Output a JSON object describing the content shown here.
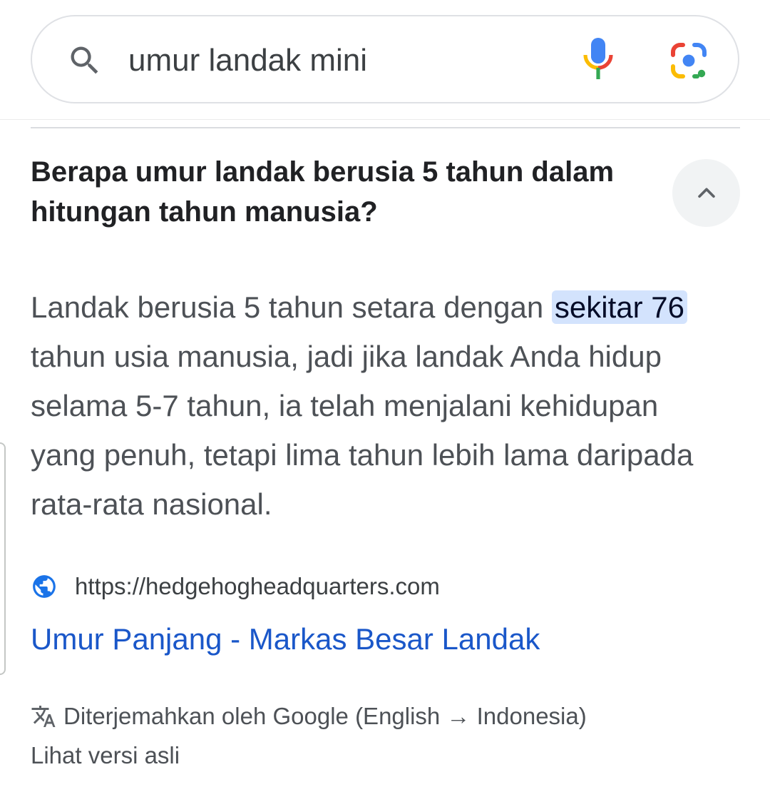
{
  "search": {
    "query": "umur landak mini",
    "icons": {
      "search": "search-icon",
      "mic": "mic-icon",
      "lens": "google-lens-icon"
    }
  },
  "faq": {
    "question": "Berapa umur landak berusia 5 tahun dalam hitungan tahun manusia?",
    "collapse_icon": "chevron-up-icon",
    "answer_before": "Landak berusia 5 tahun setara dengan ",
    "answer_highlight": "sekitar 76",
    "answer_after": " tahun usia manusia, jadi jika landak Anda hidup selama 5-7 tahun, ia telah menjalani kehidupan yang penuh, tetapi lima tahun lebih lama daripada rata-rata nasional."
  },
  "source": {
    "icon": "globe-icon",
    "url": "https://hedgehogheadquarters.com",
    "title": "Umur Panjang - Markas Besar Landak"
  },
  "translation": {
    "icon": "translate-icon",
    "notice": "Diterjemahkan oleh Google (English → Indonesia)",
    "view_original": "Lihat versi asli"
  },
  "colors": {
    "link": "#1a57c9",
    "highlight_bg": "#d3e3fd",
    "body_text": "#4d5156",
    "heading": "#202124"
  }
}
